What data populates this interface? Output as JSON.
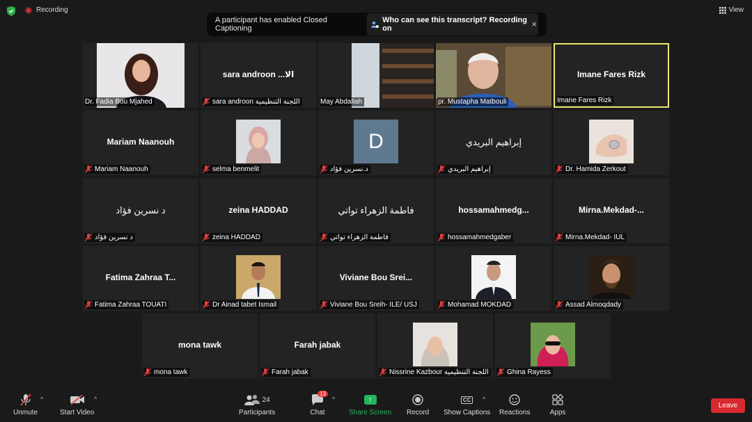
{
  "topbar": {
    "recording_label": "Recording",
    "view_label": "View"
  },
  "banner": {
    "text": "A participant has enabled Closed Captioning",
    "link": "Who can see this transcript? Recording on",
    "close": "×"
  },
  "tiles": [
    {
      "label": "Dr. Fadia Bou Mjahed",
      "name": "",
      "muted": false
    },
    {
      "label": "sara androon اللجنة التنظيمية",
      "name": "sara androon ...الا",
      "muted": true
    },
    {
      "label": "May Abdallah",
      "name": "",
      "muted": false
    },
    {
      "label": "pr. Mustapha Matbouli",
      "name": "",
      "muted": false
    },
    {
      "label": "Imane Fares Rizk",
      "name": "Imane Fares Rizk",
      "muted": false
    },
    {
      "label": "Mariam Naanouh",
      "name": "Mariam Naanouh",
      "muted": true
    },
    {
      "label": "selma benmelit",
      "name": "",
      "muted": true
    },
    {
      "label": "د.نسرين فؤاد",
      "name": "D",
      "muted": true
    },
    {
      "label": "إبراهيم البريدي",
      "name": "إبراهيم البريدي",
      "muted": true
    },
    {
      "label": "Dr. Hamida Zerkout",
      "name": "",
      "muted": true
    },
    {
      "label": "د نسرين فؤاد",
      "name": "د نسرين فؤاد",
      "muted": true
    },
    {
      "label": "zeina HADDAD",
      "name": "zeina HADDAD",
      "muted": true
    },
    {
      "label": "فاطمة الزهراء تواتي",
      "name": "فاطمة الزهراء تواتي",
      "muted": true
    },
    {
      "label": "hossamahmedgaber",
      "name": "hossamahmedg...",
      "muted": true
    },
    {
      "label": "Mirna.Mekdad- IUL",
      "name": "Mirna.Mekdad-...",
      "muted": true
    },
    {
      "label": "Fatima Zahraa TOUATI",
      "name": "Fatima Zahraa T...",
      "muted": true
    },
    {
      "label": "Dr Ainad tabet Ismail",
      "name": "",
      "muted": true
    },
    {
      "label": "Viviane Bou Sreih- ILE/ USJ",
      "name": "Viviane Bou Srei...",
      "muted": true
    },
    {
      "label": "Mohamad MOKDAD",
      "name": "",
      "muted": true
    },
    {
      "label": "Assad Almoqdady",
      "name": "",
      "muted": true
    },
    {
      "label": "mona tawk",
      "name": "mona tawk",
      "muted": true
    },
    {
      "label": "Farah jabak",
      "name": "Farah jabak",
      "muted": true
    },
    {
      "label": "Nissrine Kazbour اللجنة التنظيمية",
      "name": "",
      "muted": true
    },
    {
      "label": "Ghina Rayess",
      "name": "",
      "muted": true
    }
  ],
  "toolbar": {
    "unmute": "Unmute",
    "start_video": "Start Video",
    "participants": "Participants",
    "participants_count": "24",
    "chat": "Chat",
    "chat_badge": "13",
    "share_screen": "Share Screen",
    "record": "Record",
    "show_captions": "Show Captions",
    "cc_glyph": "CC",
    "reactions": "Reactions",
    "apps": "Apps",
    "leave": "Leave"
  },
  "colors": {
    "active_border": "#e8e870",
    "share_green": "#23b55e",
    "leave_red": "#d8292e"
  }
}
